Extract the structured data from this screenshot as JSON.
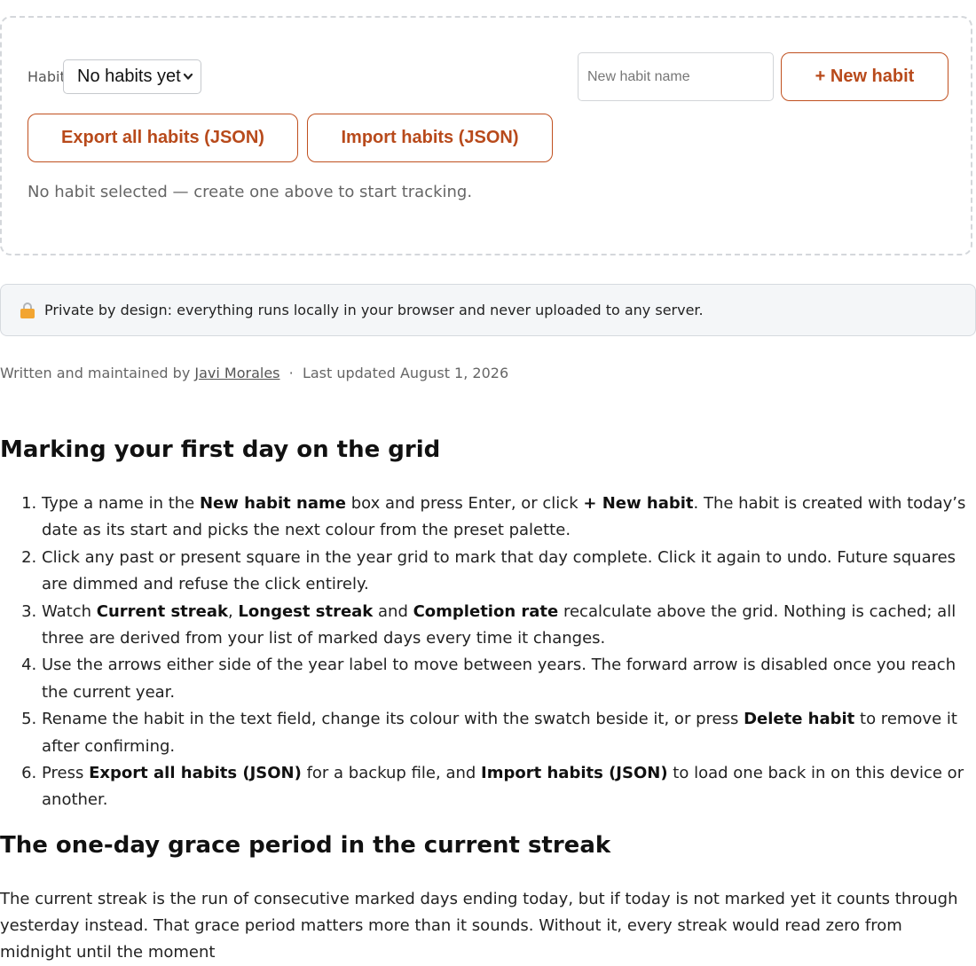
{
  "tracker": {
    "habit_label": "Habit",
    "habit_select_value": "No habits yet",
    "new_habit_placeholder": "New habit name",
    "new_habit_button": "+ New habit",
    "export_button": "Export all habits (JSON)",
    "import_button": "Import habits (JSON)",
    "status": "No habit selected — create one above to start tracking."
  },
  "privacy": {
    "icon": "lock-icon",
    "text": "Private by design: everything runs locally in your browser and never uploaded to any server."
  },
  "byline": {
    "prefix": "Written and maintained by",
    "author": "Javi Morales",
    "separator": "·",
    "updated": "Last updated August 1, 2026"
  },
  "section1": {
    "heading": "Marking your first day on the grid",
    "steps": [
      [
        {
          "t": "Type a name in the "
        },
        {
          "b": "New habit name"
        },
        {
          "t": " box and press Enter, or click "
        },
        {
          "b": "+ New habit"
        },
        {
          "t": ". The habit is created with today’s date as its start and picks the next colour from the preset palette."
        }
      ],
      [
        {
          "t": "Click any past or present square in the year grid to mark that day complete. Click it again to undo. Future squares are dimmed and refuse the click entirely."
        }
      ],
      [
        {
          "t": "Watch "
        },
        {
          "b": "Current streak"
        },
        {
          "t": ", "
        },
        {
          "b": "Longest streak"
        },
        {
          "t": " and "
        },
        {
          "b": "Completion rate"
        },
        {
          "t": " recalculate above the grid. Nothing is cached; all three are derived from your list of marked days every time it changes."
        }
      ],
      [
        {
          "t": "Use the arrows either side of the year label to move between years. The forward arrow is disabled once you reach the current year."
        }
      ],
      [
        {
          "t": "Rename the habit in the text field, change its colour with the swatch beside it, or press "
        },
        {
          "b": "Delete habit"
        },
        {
          "t": " to remove it after confirming."
        }
      ],
      [
        {
          "t": "Press "
        },
        {
          "b": "Export all habits (JSON)"
        },
        {
          "t": " for a backup file, and "
        },
        {
          "b": "Import habits (JSON)"
        },
        {
          "t": " to load one back in on this device or another."
        }
      ]
    ]
  },
  "section2": {
    "heading": "The one-day grace period in the current streak",
    "paragraph": "The current streak is the run of consecutive marked days ending today, but if today is not marked yet it counts through yesterday instead. That grace period matters more than it sounds. Without it, every streak would read zero from midnight until the moment"
  }
}
